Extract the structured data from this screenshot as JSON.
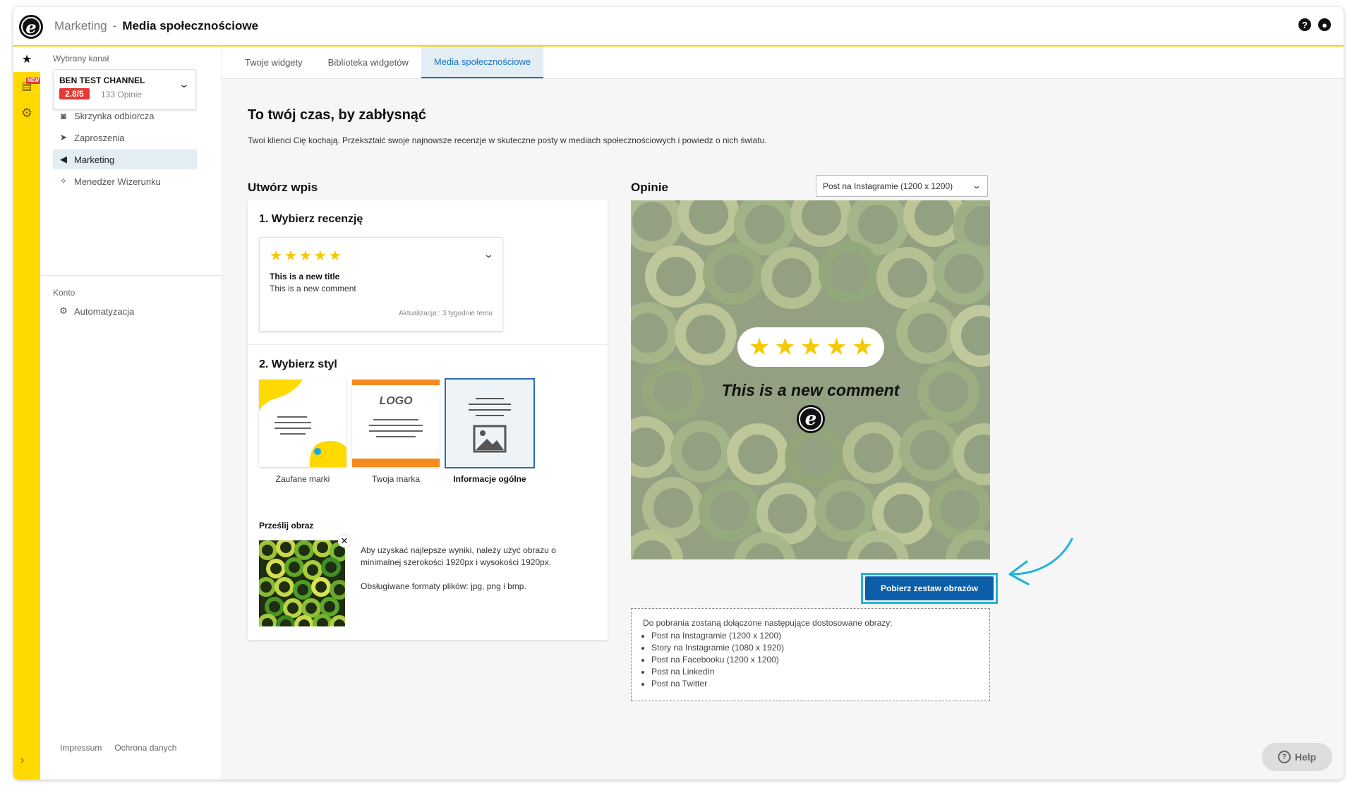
{
  "header": {
    "parent": "Marketing",
    "separator": "-",
    "current": "Media społecznościowe",
    "help_icon": "question-circle-icon",
    "user_icon": "user-circle-icon"
  },
  "rail": {
    "new_badge": "NEW"
  },
  "sidebar": {
    "channel_label": "Wybrany kanał",
    "channel_name": "BEN TEST CHANNEL",
    "channel_score": "2.8/5",
    "channel_reviews": "133 Opinie",
    "items": [
      {
        "label": "Skrzynka odbiorcza",
        "icon": "inbox-icon"
      },
      {
        "label": "Zaproszenia",
        "icon": "paper-plane-icon"
      },
      {
        "label": "Marketing",
        "icon": "megaphone-icon"
      },
      {
        "label": "Menedżer Wizerunku",
        "icon": "sparkle-icon"
      }
    ],
    "account_label": "Konto",
    "account_items": [
      {
        "label": "Automatyzacja",
        "icon": "robot-icon"
      }
    ],
    "footer": [
      "Impressum",
      "Ochrona danych"
    ]
  },
  "tabs": [
    {
      "label": "Twoje widgety"
    },
    {
      "label": "Biblioteka widgetów"
    },
    {
      "label": "Media społecznościowe"
    }
  ],
  "main": {
    "title": "To twój czas, by zabłysnąć",
    "description": "Twoi klienci Cię kochają. Przekształć swoje najnowsze recenzje w skuteczne posty w mediach społecznościowych i powiedz o nich światu.",
    "create_title": "Utwórz wpis",
    "reviews_title": "Opinie",
    "step1": "1. Wybierz recenzję",
    "review": {
      "stars": "★★★★★",
      "title": "This is a new title",
      "comment": "This is a new comment",
      "updated": "Aktualizacja:: 3 tygodnie temu"
    },
    "step2": "2. Wybierz styl",
    "styles": [
      {
        "label": "Zaufane marki"
      },
      {
        "label": "Twoja marka",
        "logo_text": "LOGO"
      },
      {
        "label": "Informacje ogólne"
      }
    ],
    "upload_label": "Prześlij obraz",
    "upload_info_1": "Aby uzyskać najlepsze wyniki, należy użyć obrazu o minimalnej szerokości 1920px i wysokości 1920px.",
    "upload_info_2": "Obsługiwane formaty plików: jpg, png i bmp.",
    "format_select": "Post na Instagramie (1200 x 1200)",
    "preview": {
      "stars": "★★★★★",
      "comment": "This is a new comment"
    },
    "download_button": "Pobierz zestaw obrazów",
    "includes_title": "Do pobrania zostaną dołączone następujące dostosowane obrazy:",
    "includes": [
      "Post na Instagramie (1200 x 1200)",
      "Story na Instagramie (1080 x 1920)",
      "Post na Facebooku (1200 x 1200)",
      "Post na LinkedIn",
      "Post na Twitter"
    ],
    "help": "Help"
  },
  "colors": {
    "brand_yellow": "#ffd900",
    "accent_blue": "#0d5ea8",
    "highlight_cyan": "#1fb5d8",
    "score_red": "#e53935",
    "star_yellow": "#f5c800"
  }
}
